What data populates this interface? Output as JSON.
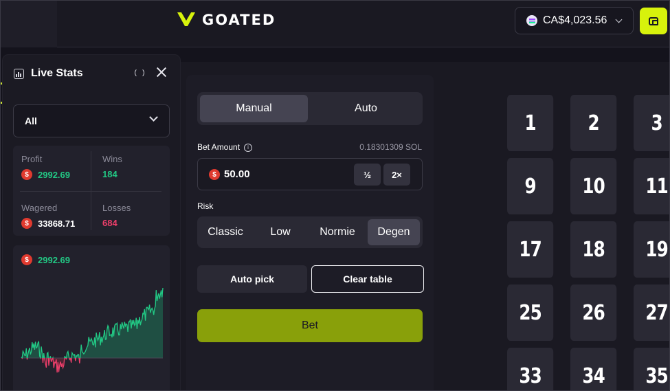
{
  "header": {
    "brand": "GOATED",
    "balance": "CA$4,023.56",
    "balance_coin_icon": "solana-coin-icon",
    "wallet_icon": "wallet-icon",
    "accent": "#d7f20c"
  },
  "live_stats": {
    "title": "Live Stats",
    "filter": "All",
    "profit_label": "Profit",
    "profit_value": "2992.69",
    "wins_label": "Wins",
    "wins_value": "184",
    "wagered_label": "Wagered",
    "wagered_value": "33868.71",
    "losses_label": "Losses",
    "losses_value": "684",
    "chart_value": "2992.69",
    "coin_glyph": "$"
  },
  "game": {
    "tabs": [
      "Manual",
      "Auto"
    ],
    "active_tab": "Manual",
    "bet_amount_label": "Bet Amount",
    "bet_amount_sol": "0.18301309 SOL",
    "bet_amount_value": "50.00",
    "half_label": "½",
    "double_label": "2×",
    "risk_label": "Risk",
    "risk_options": [
      "Classic",
      "Low",
      "Normie",
      "Degen"
    ],
    "active_risk": "Degen",
    "auto_pick_label": "Auto pick",
    "clear_table_label": "Clear table",
    "bet_label": "Bet"
  },
  "board": {
    "tiles": [
      [
        "1",
        "2",
        "3"
      ],
      [
        "9",
        "10",
        "11"
      ],
      [
        "17",
        "18",
        "19"
      ],
      [
        "25",
        "26",
        "27"
      ],
      [
        "33",
        "34",
        "35"
      ]
    ]
  }
}
